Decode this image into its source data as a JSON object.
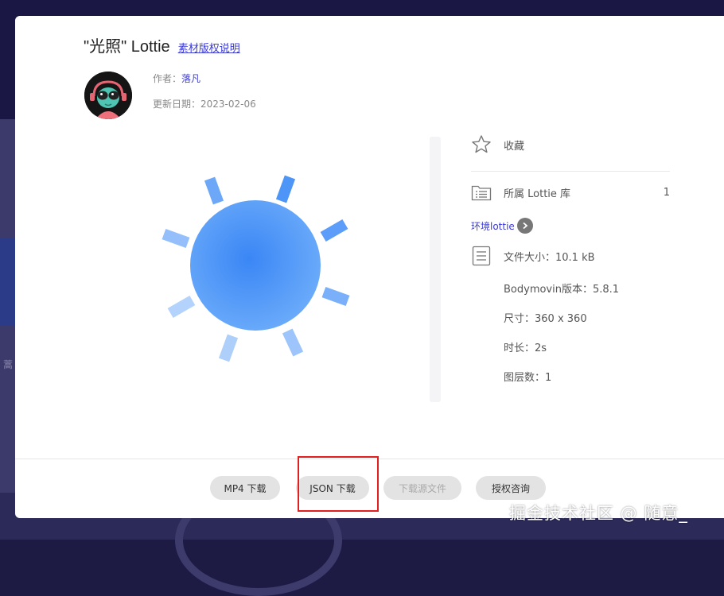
{
  "modal": {
    "title": "\"光照\" Lottie",
    "copyright_link": "素材版权说明",
    "author_label": "作者：",
    "author_name": "落凡",
    "update_date": "更新日期：2023-02-06"
  },
  "info": {
    "favorite_label": "收藏",
    "library_label": "所属 Lottie 库",
    "library_count": "1",
    "library_link": "环境lottie",
    "file_size": "文件大小：10.1 kB",
    "bodymovin_version": "Bodymovin版本：5.8.1",
    "dimensions": "尺寸：360 x 360",
    "duration": "时长：2s",
    "layers": "图层数：1"
  },
  "footer": {
    "mp4_download": "MP4 下载",
    "json_download": "JSON 下载",
    "source_download": "下载源文件",
    "license_consult": "授权咨询"
  },
  "background": {
    "partial_text": "蒿"
  },
  "watermark": "掘金技术社区 @ 随意_",
  "colors": {
    "sun": "#4d95f7",
    "accent_link": "#3b3bd6",
    "highlight": "#e02020"
  },
  "icons": {
    "favorite": "star-outline-icon",
    "library": "folder-list-icon",
    "file": "document-icon",
    "go": "chevron-right-icon"
  }
}
